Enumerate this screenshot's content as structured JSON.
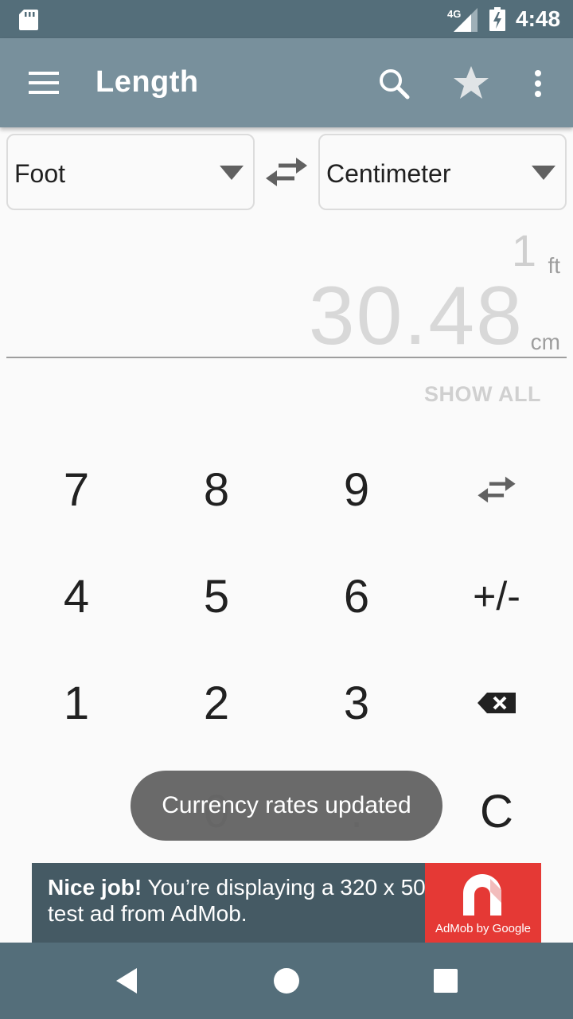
{
  "status_bar": {
    "network": "4G",
    "time": "4:48"
  },
  "app_bar": {
    "title": "Length"
  },
  "converter": {
    "from_unit": "Foot",
    "to_unit": "Centimeter",
    "input_value": "1",
    "input_unit": "ft",
    "result_value": "30.48",
    "result_unit": "cm",
    "show_all_label": "SHOW ALL"
  },
  "keypad": {
    "rows": [
      [
        "7",
        "8",
        "9",
        "swap"
      ],
      [
        "4",
        "5",
        "6",
        "+/-"
      ],
      [
        "1",
        "2",
        "3",
        "backspace"
      ],
      [
        "",
        "0",
        ".",
        "C"
      ]
    ],
    "k7": "7",
    "k8": "8",
    "k9": "9",
    "k4": "4",
    "k5": "5",
    "k6": "6",
    "sign": "+/-",
    "k1": "1",
    "k2": "2",
    "k3": "3",
    "k0": "0",
    "dot": ".",
    "clear": "C"
  },
  "toast": {
    "text": "Currency rates updated"
  },
  "ad": {
    "bold_text": "Nice job!",
    "text": " You’re displaying a 320 x 50 test ad from AdMob.",
    "brand": "AdMob by Google"
  },
  "colors": {
    "status_bar": "#546e7a",
    "app_bar": "#78909c",
    "ad_background": "#455a64",
    "ad_logo": "#e53935"
  }
}
